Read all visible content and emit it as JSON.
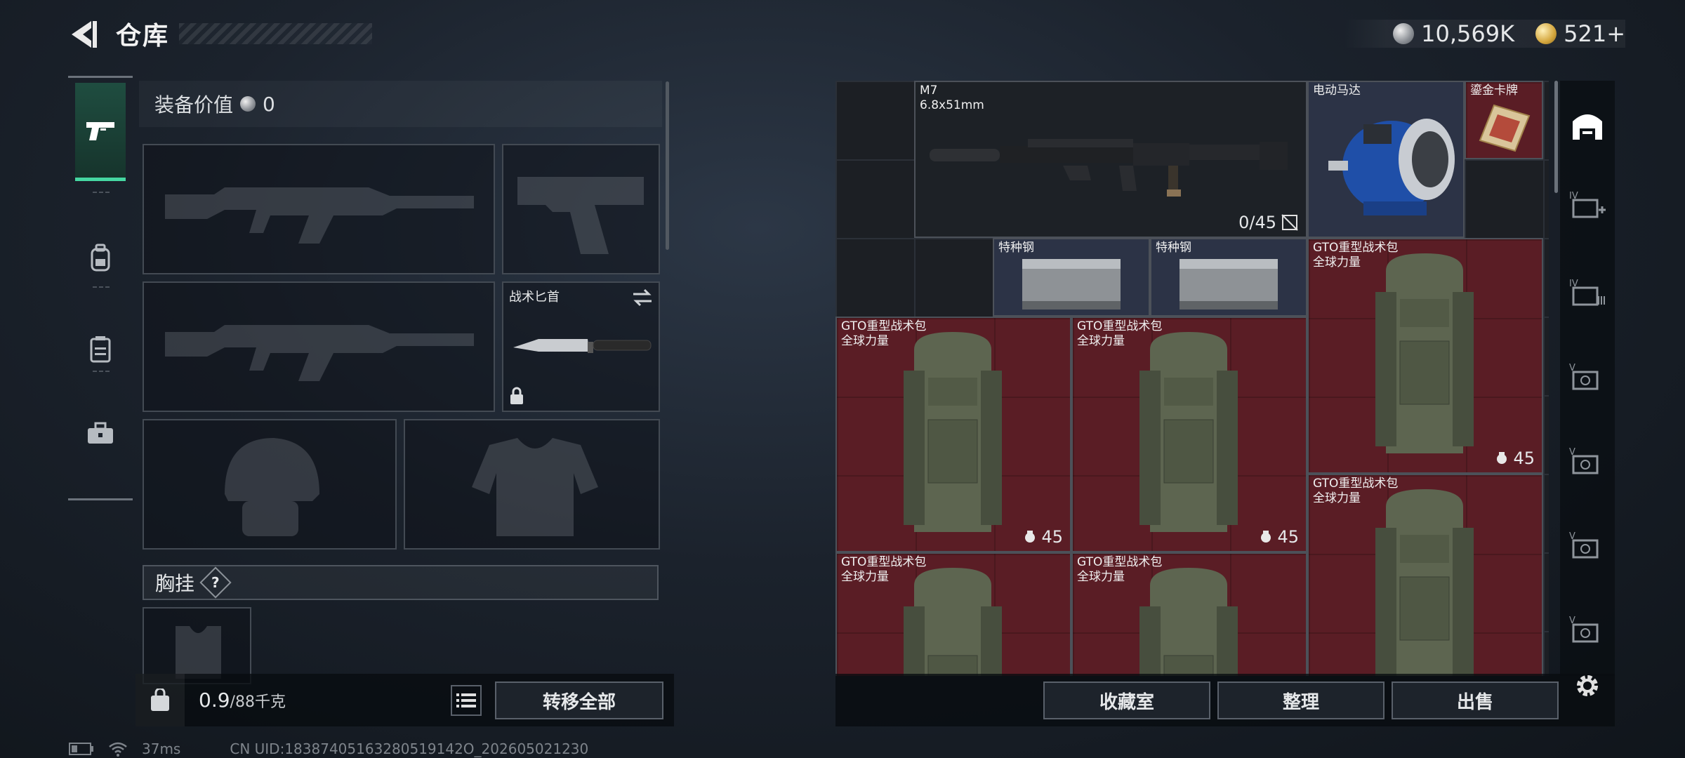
{
  "header": {
    "title": "仓库"
  },
  "currency": {
    "silver": "10,569K",
    "gold": "521+"
  },
  "equipment": {
    "value_label": "装备价值",
    "value": "0",
    "knife_label": "战术匕首",
    "chest_label": "胸挂",
    "chest_help": "?"
  },
  "inventory": {
    "weight": "0.9",
    "capacity": "/88千克",
    "transfer_all": "转移全部"
  },
  "storage": {
    "items": [
      {
        "name": "M7",
        "sub": "6.8x51mm",
        "count": "0/45"
      },
      {
        "name": "电动马达"
      },
      {
        "name": "鎏金卡牌"
      },
      {
        "name": "特种钢"
      },
      {
        "name": "特种钢"
      },
      {
        "name": "GTO重型战术包",
        "sub": "全球力量",
        "count": "45"
      },
      {
        "name": "GTO重型战术包",
        "sub": "全球力量",
        "count": "45"
      },
      {
        "name": "GTO重型战术包",
        "sub": "全球力量",
        "count": "45"
      },
      {
        "name": "GTO重型战术包",
        "sub": "全球力量"
      },
      {
        "name": "GTO重型战术包",
        "sub": "全球力量"
      },
      {
        "name": "GTO重型战术包",
        "sub": "全球力量"
      }
    ],
    "buttons": {
      "collection": "收藏室",
      "organize": "整理",
      "sell": "出售"
    }
  },
  "status": {
    "ping": "37ms",
    "uid": "CN UID:18387405163280519142O_202605021230"
  },
  "colors": {
    "accent": "#46d7a2",
    "rarity_red": "#5a1d25",
    "rarity_blue": "#2c3346"
  },
  "icons": [
    "back-arrow-icon",
    "gun-icon",
    "backpack-icon",
    "vest-icon",
    "toolbox-icon",
    "warehouse-icon",
    "settings-icon"
  ]
}
